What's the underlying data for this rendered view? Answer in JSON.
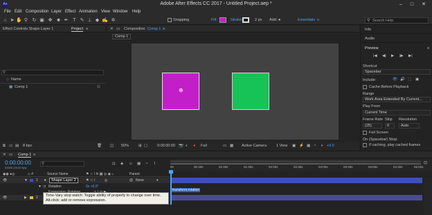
{
  "window": {
    "title": "Adobe After Effects CC 2017 - Untitled Project.aep *",
    "app_icon": "Ae",
    "minimize": "–",
    "maximize": "□",
    "close": "✕"
  },
  "menu": [
    "File",
    "Edit",
    "Composition",
    "Layer",
    "Effect",
    "Animation",
    "View",
    "Window",
    "Help"
  ],
  "toolbar": {
    "snapping_label": "Snapping",
    "fill_label": "Fill:",
    "fill_color": "#c31fc9",
    "stroke_label": "Stroke:",
    "stroke_width": "2 px",
    "add_label": "Add:",
    "workspace": "Essentials",
    "search_placeholder": "Search Help"
  },
  "left_panel": {
    "tab_effect_controls": "Effect Controls Shape Layer 1",
    "tab_project": "Project",
    "col_name": "Name",
    "item_comp": "Comp 1",
    "bpc": "8 bpc"
  },
  "composition_panel": {
    "tab_label": "Composition",
    "tab_comp_name": "Comp 1",
    "subtab": "Comp 1",
    "magenta_color": "#c31fc9",
    "green_color": "#17c257",
    "zoom": "50%",
    "timecode": "0:00:00:00",
    "resolution": "Full",
    "camera": "Active Camera",
    "view": "1 View",
    "exposure": "+0.0"
  },
  "right_panel": {
    "info": "Info",
    "audio": "Audio",
    "preview": "Preview",
    "shortcut_label": "Shortcut",
    "shortcut_value": "Spacebar",
    "include_label": "Include:",
    "cache_before": "Cache Before Playback",
    "range_label": "Range",
    "range_value": "Work Area Extended By Current...",
    "play_from_label": "Play From",
    "play_from_value": "Current Time",
    "frame_rate_label": "Frame Rate",
    "skip_label": "Skip",
    "resolution_label": "Resolution",
    "frame_rate_value": "(25)",
    "skip_value": "0",
    "resolution_value": "Auto",
    "full_screen": "Full Screen",
    "on_stop_label": "On (Spacebar) Stop:",
    "if_caching": "If caching, play cached frames"
  },
  "timeline": {
    "tab_label": "Comp 1",
    "timecode": "0:00:00:00",
    "timecode_sub": "00000 (25.00 fps)",
    "search_placeholder": "",
    "col_source": "Source Name",
    "col_parent": "Parent",
    "layer1_num": "1",
    "layer1_name": "Shape Layer 2",
    "layer1_parent": "None",
    "rotation_label": "Rotation",
    "rotation_value": "0x +0.0°",
    "expression_label": "Expression: Rotation",
    "layer2_num": "2",
    "expression_text": "transform.rotation",
    "ruler": [
      "0s",
      "00:30s",
      "01:00s",
      "01:30s",
      "02:00s",
      "02:30s",
      "03:00s",
      "03:30s",
      "04:00s",
      "04:30s",
      "05:00s"
    ],
    "tooltip": "Time-Vary stop watch: Toggle ability of property to change over time. Alt-click: add or remove expression."
  }
}
